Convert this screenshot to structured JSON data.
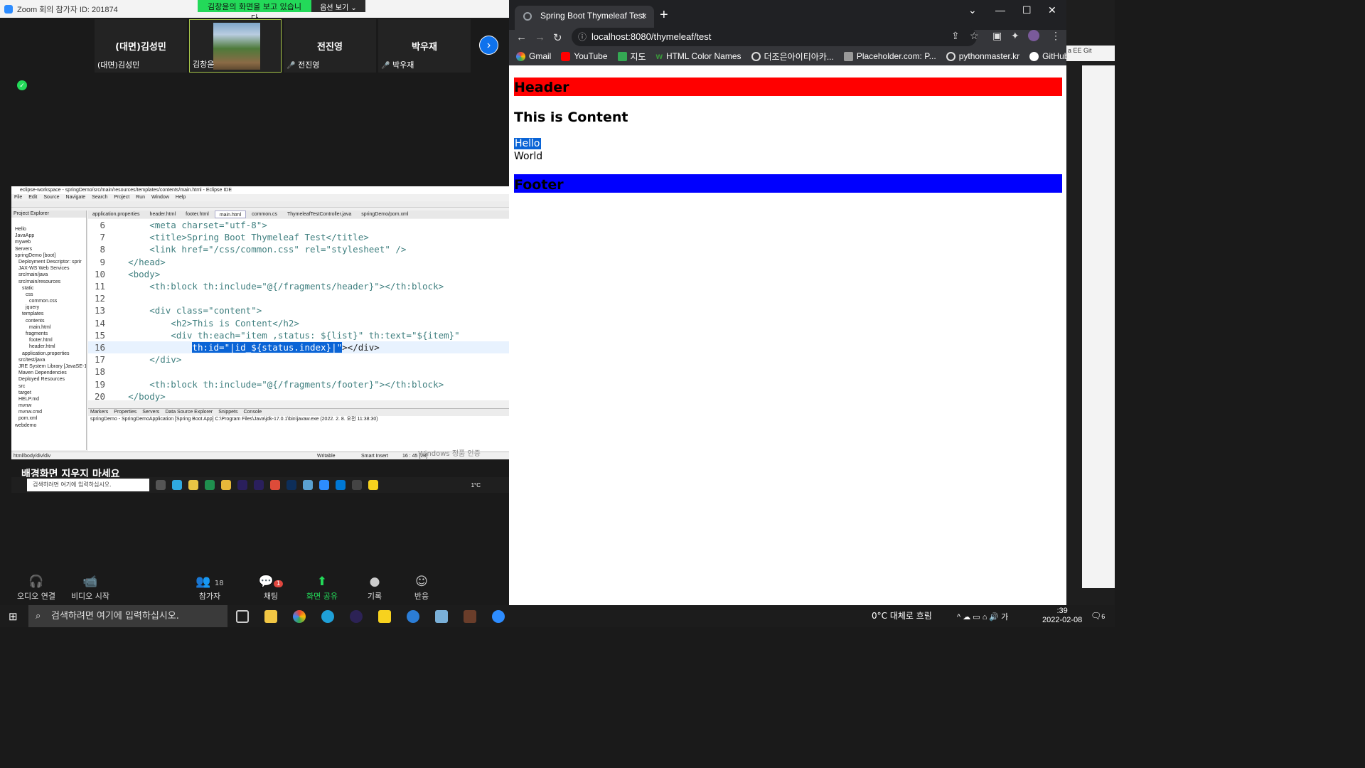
{
  "zoom": {
    "title": "Zoom 회의 참가자 ID: 201874",
    "share_banner": "김창윤의 화면을 보고 있습니다",
    "options_label": "옵션 보기 ⌄",
    "participants": [
      {
        "big": "(대면)김성민",
        "small": "(대면)김성민"
      },
      {
        "big": "",
        "small": "김창윤"
      },
      {
        "big": "전진영",
        "small": "전진영"
      },
      {
        "big": "박우재",
        "small": "박우재"
      }
    ],
    "background_note": "배경화면 지우지 마세요",
    "watermark": "Windows 정품 인증",
    "toolbar": {
      "audio": "오디오 연결",
      "video": "비디오 시작",
      "participants": "참가자",
      "participants_count": "18",
      "chat": "채팅",
      "chat_badge": "1",
      "share": "화면 공유",
      "record": "기록",
      "reactions": "반응"
    }
  },
  "eclipse": {
    "title": "eclipse-workspace - springDemo/src/main/resources/templates/contents/main.html - Eclipse IDE",
    "menu": [
      "File",
      "Edit",
      "Source",
      "Navigate",
      "Search",
      "Project",
      "Run",
      "Window",
      "Help"
    ],
    "explorer_title": "Project Explorer",
    "tree": [
      "Hello",
      "JavaApp",
      "myweb",
      "Servers",
      "springDemo [boot]",
      "Deployment Descriptor: sprir",
      "JAX-WS Web Services",
      "src/main/java",
      "src/main/resources",
      "static",
      "css",
      "common.css",
      "jquery",
      "templates",
      "contents",
      "main.html",
      "fragments",
      "footer.html",
      "header.html",
      "application.properties",
      "src/test/java",
      "JRE System Library [JavaSE-1",
      "Maven Dependencies",
      "Deployed Resources",
      "src",
      "target",
      "HELP.md",
      "mvnw",
      "mvnw.cmd",
      "pom.xml",
      "webdemo"
    ],
    "tabs": [
      "application.properties",
      "header.html",
      "footer.html",
      "main.html",
      "common.cs",
      "ThymeleafTestController.java",
      "springDemo/pom.xml"
    ],
    "code_lines": [
      {
        "n": "6",
        "code": "        <meta charset=\"utf-8\">"
      },
      {
        "n": "7",
        "code": "        <title>Spring Boot Thymeleaf Test</title>"
      },
      {
        "n": "8",
        "code": "        <link href=\"/css/common.css\" rel=\"stylesheet\" />"
      },
      {
        "n": "9",
        "code": "    </head>"
      },
      {
        "n": "10",
        "code": "    <body>"
      },
      {
        "n": "11",
        "code": "        <th:block th:include=\"@{/fragments/header}\"></th:block>"
      },
      {
        "n": "12",
        "code": ""
      },
      {
        "n": "13",
        "code": "        <div class=\"content\">"
      },
      {
        "n": "14",
        "code": "            <h2>This is Content</h2>"
      },
      {
        "n": "15",
        "code": "            <div th:each=\"item ,status: ${list}\" th:text=\"${item}\""
      },
      {
        "n": "16",
        "code": "                th:id=\"|id_${status.index}|\"></div>"
      },
      {
        "n": "17",
        "code": "        </div>"
      },
      {
        "n": "18",
        "code": ""
      },
      {
        "n": "19",
        "code": "        <th:block th:include=\"@{/fragments/footer}\"></th:block>"
      },
      {
        "n": "20",
        "code": "    </body>"
      }
    ],
    "bottom_tabs": [
      "Markers",
      "Properties",
      "Servers",
      "Data Source Explorer",
      "Snippets",
      "Console"
    ],
    "console_text": "springDemo - SpringDemoApplication [Spring Boot App] C:\\Program Files\\Java\\jdk-17.0.1\\bin\\javaw.exe (2022. 2. 8. 오전 11:38:30)",
    "status_path": "html/body/div/div",
    "status_mode": "Writable",
    "status_insert": "Smart Insert",
    "status_pos": "16 : 45 [28]"
  },
  "inner_taskbar": {
    "search": "검색하려면 여기에 입력하십시오.",
    "weather": "1°C"
  },
  "chrome": {
    "tab_title": "Spring Boot Thymeleaf Test",
    "url": "localhost:8080/thymeleaf/test",
    "bookmarks": [
      "Gmail",
      "YouTube",
      "지도",
      "HTML Color Names",
      "더조은아이티아카...",
      "Placeholder.com: P...",
      "pythonmaster.kr",
      "GitHub"
    ],
    "page": {
      "header": "Header",
      "h2": "This is Content",
      "items": [
        "Hello",
        "World"
      ],
      "footer": "Footer"
    }
  },
  "right_sliver": {
    "label": "a EE  Git"
  },
  "taskbar": {
    "search": "검색하려면 여기에 입력하십시오.",
    "weather": "0°C  대체로 흐림",
    "time": ":39",
    "date": "2022-02-08",
    "notif": "6"
  }
}
